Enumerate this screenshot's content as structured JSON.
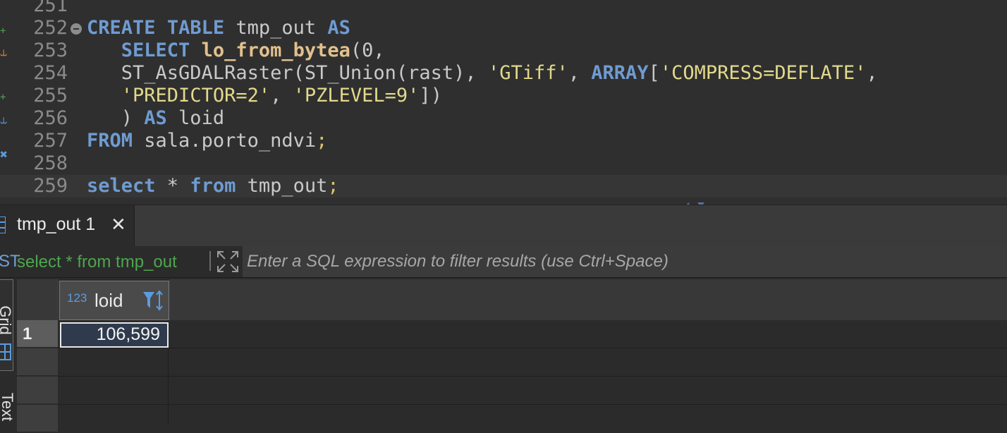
{
  "editor": {
    "line_numbers": [
      "251",
      "252",
      "253",
      "254",
      "255",
      "256",
      "257",
      "258",
      "259"
    ],
    "lines": [
      [],
      [
        {
          "t": "CREATE",
          "c": "kw"
        },
        {
          "t": " "
        },
        {
          "t": "TABLE",
          "c": "kw"
        },
        {
          "t": " tmp_out "
        },
        {
          "t": "AS",
          "c": "kw"
        }
      ],
      [
        {
          "t": "   "
        },
        {
          "t": "SELECT",
          "c": "kw"
        },
        {
          "t": " "
        },
        {
          "t": "lo_from_bytea",
          "c": "fn"
        },
        {
          "t": "(0,"
        }
      ],
      [
        {
          "t": "   ST_AsGDALRaster(ST_Union(rast), "
        },
        {
          "t": "'GTiff'",
          "c": "str"
        },
        {
          "t": ", "
        },
        {
          "t": "ARRAY",
          "c": "kw"
        },
        {
          "t": "["
        },
        {
          "t": "'COMPRESS=DEFLATE'",
          "c": "str"
        },
        {
          "t": ","
        }
      ],
      [
        {
          "t": "   "
        },
        {
          "t": "'PREDICTOR=2'",
          "c": "str"
        },
        {
          "t": ", "
        },
        {
          "t": "'PZLEVEL=9'",
          "c": "str"
        },
        {
          "t": "])"
        }
      ],
      [
        {
          "t": "   ) "
        },
        {
          "t": "AS",
          "c": "kw"
        },
        {
          "t": " loid"
        }
      ],
      [
        {
          "t": "FROM",
          "c": "kw"
        },
        {
          "t": " sala.porto_ndvi"
        },
        {
          "t": ";",
          "c": "semi"
        }
      ],
      [],
      [
        {
          "t": "select",
          "c": "kw"
        },
        {
          "t": " * "
        },
        {
          "t": "from",
          "c": "kw"
        },
        {
          "t": " tmp_out"
        },
        {
          "t": ";",
          "c": "semi"
        }
      ]
    ],
    "fold_line": "252",
    "current_line": "259"
  },
  "results": {
    "tab_label": "tmp_out 1",
    "tab_close": "✕",
    "query_label": "select * from tmp_out",
    "filter_placeholder": "Enter a SQL expression to filter results (use Ctrl+Space)",
    "side_tabs": [
      "Grid",
      "Text"
    ],
    "columns": [
      {
        "type_badge": "123",
        "name": "loid"
      }
    ],
    "rows": [
      {
        "num": "1",
        "loid": "106,599"
      }
    ]
  },
  "colors": {
    "keyword": "#6f9bd1",
    "function": "#e2c08d",
    "string": "#e2d98b",
    "query_green": "#4ea64e",
    "accent_blue": "#5b9be0"
  }
}
